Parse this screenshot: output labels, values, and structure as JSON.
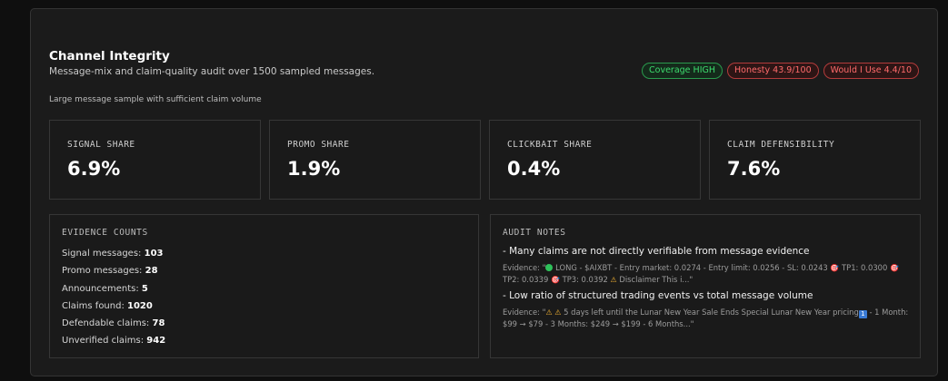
{
  "header": {
    "title": "Channel Integrity",
    "subtitle": "Message-mix and claim-quality audit over 1500 sampled messages.",
    "note": "Large message sample with sufficient claim volume"
  },
  "badges": {
    "coverage": "Coverage HIGH",
    "honesty": "Honesty 43.9/100",
    "would_use": "Would I Use 4.4/10",
    "colors": {
      "green": "#3ddc6e",
      "red": "#ff6b6b"
    }
  },
  "stats": [
    {
      "label": "SIGNAL SHARE",
      "value": "6.9%"
    },
    {
      "label": "PROMO SHARE",
      "value": "1.9%"
    },
    {
      "label": "CLICKBAIT SHARE",
      "value": "0.4%"
    },
    {
      "label": "CLAIM DEFENSIBILITY",
      "value": "7.6%"
    }
  ],
  "evidence_counts": {
    "header": "EVIDENCE COUNTS",
    "rows": [
      {
        "label": "Signal messages: ",
        "value": "103"
      },
      {
        "label": "Promo messages: ",
        "value": "28"
      },
      {
        "label": "Announcements: ",
        "value": "5"
      },
      {
        "label": "Claims found: ",
        "value": "1020"
      },
      {
        "label": "Defendable claims: ",
        "value": "78"
      },
      {
        "label": "Unverified claims: ",
        "value": "942"
      }
    ]
  },
  "audit_notes": {
    "header": "AUDIT NOTES",
    "items": [
      {
        "claim": "- Many claims are not directly verifiable from message evidence",
        "ev_prefix": "Evidence: \"",
        "ev_a": " LONG - $AIXBT - Entry market: 0.0274 - Entry limit: 0.0256 - SL: 0.0243 ",
        "ev_b": " TP1: 0.0300 ",
        "ev_c": " TP2: 0.0339 ",
        "ev_d": " TP3: 0.0392 ",
        "ev_e": " Disclaimer This i...\""
      },
      {
        "claim": "- Low ratio of structured trading events vs total message volume",
        "ev_prefix": "Evidence: \"",
        "ev_a": " 5 days left until the Lunar New Year Sale Ends Special Lunar New Year pricing",
        "ev_b": " - 1 Month: $99 → $79 - 3 Months: $249 → $199 - 6 Months...\""
      }
    ]
  },
  "icons": {
    "target": "🎯",
    "warning": "⚠",
    "keycap_one": "1",
    "green_circle": "green-circle"
  }
}
